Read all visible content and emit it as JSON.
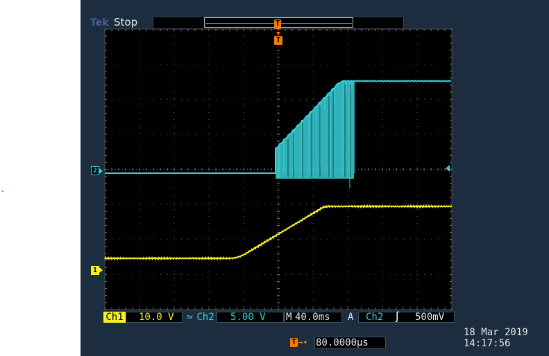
{
  "status": {
    "brand": "Tek",
    "run_state": "Stop"
  },
  "markers": {
    "trigger_top": "T",
    "trigger_pos": "T",
    "ch2": "2",
    "ch1": "1"
  },
  "channels": {
    "ch1": {
      "label": "Ch1",
      "scale": "10.0 V",
      "color": "#f7ef2a"
    },
    "ch2": {
      "label": "Ch2",
      "bw": "BW",
      "scale": "5.00 V",
      "color": "#38d0d8"
    }
  },
  "timebase": {
    "label": "M",
    "value": "40.0ms"
  },
  "trigger": {
    "mode": "A",
    "source": "Ch2",
    "slope_icon": "rising-edge-icon",
    "slope_glyph": "∫",
    "level": "500mV",
    "position_value": "80.0000µs",
    "arrow_glyph": "→▾"
  },
  "datetime": {
    "date": "18 Mar 2019",
    "time": "14:17:56"
  },
  "colors": {
    "background": "#1b2d3e",
    "screen": "#000000",
    "grid": "#7a7a7a",
    "ch1": "#f7ef2a",
    "ch2": "#38d0d8",
    "trigger": "#f07a10"
  }
}
